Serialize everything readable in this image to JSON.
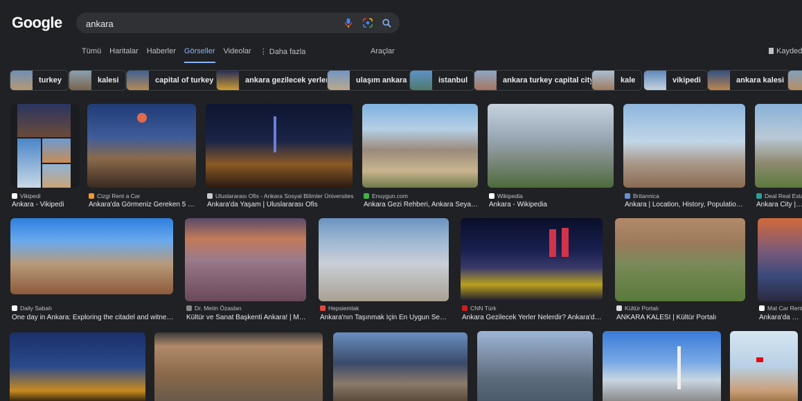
{
  "logo": "Google",
  "search": {
    "value": "ankara"
  },
  "tabs": [
    "Tümü",
    "Haritalar",
    "Haberler",
    "Görseller",
    "Videolar",
    "⋮ Daha fazla"
  ],
  "tools_label": "Araçlar",
  "saved_label": "Kaydedilenler",
  "chips": [
    "turkey",
    "kalesi",
    "capital of turkey",
    "ankara gezilecek yerler",
    "ulaşım ankara",
    "istanbul",
    "ankara turkey capital city",
    "kale",
    "vikipedi",
    "ankara kalesi"
  ],
  "results": [
    {
      "source": "Vikipedi",
      "title": "Ankara - Vikipedi"
    },
    {
      "source": "Cizgi Rent a Car",
      "title": "Ankara'da Görmeniz Gereken 5 Yer..."
    },
    {
      "source": "Uluslararası Ofis - Ankara Sosyal Bilimler Üniversitesi",
      "title": "Ankara'da Yaşam | Uluslararası Ofis"
    },
    {
      "source": "Enuygun.com",
      "title": "Ankara Gezi Rehberi, Ankara Seyahat..."
    },
    {
      "source": "Wikipedia",
      "title": "Ankara - Wikipedia"
    },
    {
      "source": "Britannica",
      "title": "Ankara | Location, History, Population, ..."
    },
    {
      "source": "Deal Real Estate",
      "title": "Ankara City | About"
    },
    {
      "source": "Daily Sabah",
      "title": "One day in Ankara: Exploring the citadel and witness..."
    },
    {
      "source": "Dr. Metin Özaslan",
      "title": "Kültür ve Sanat Başkenti Ankara! | Metin..."
    },
    {
      "source": "Hepsiemlak",
      "title": "Ankara'nın Taşınmak İçin En Uygun Semtleri"
    },
    {
      "source": "CNN Türk",
      "title": "Ankara Gezilecek Yerler Nelerdir? Ankara'da ..."
    },
    {
      "source": "Kültür Portalı",
      "title": "ANKARA KALESİ | Kültür Portalı"
    },
    {
      "source": "Mat Car Rental",
      "title": "Ankara'da Gez..."
    }
  ],
  "colors": {
    "accent": "#8ab4f8",
    "background": "#202124",
    "chip_border": "#3c4043"
  },
  "icons": [
    "mic-icon",
    "lens-icon",
    "search-icon",
    "bookmark-icon"
  ]
}
